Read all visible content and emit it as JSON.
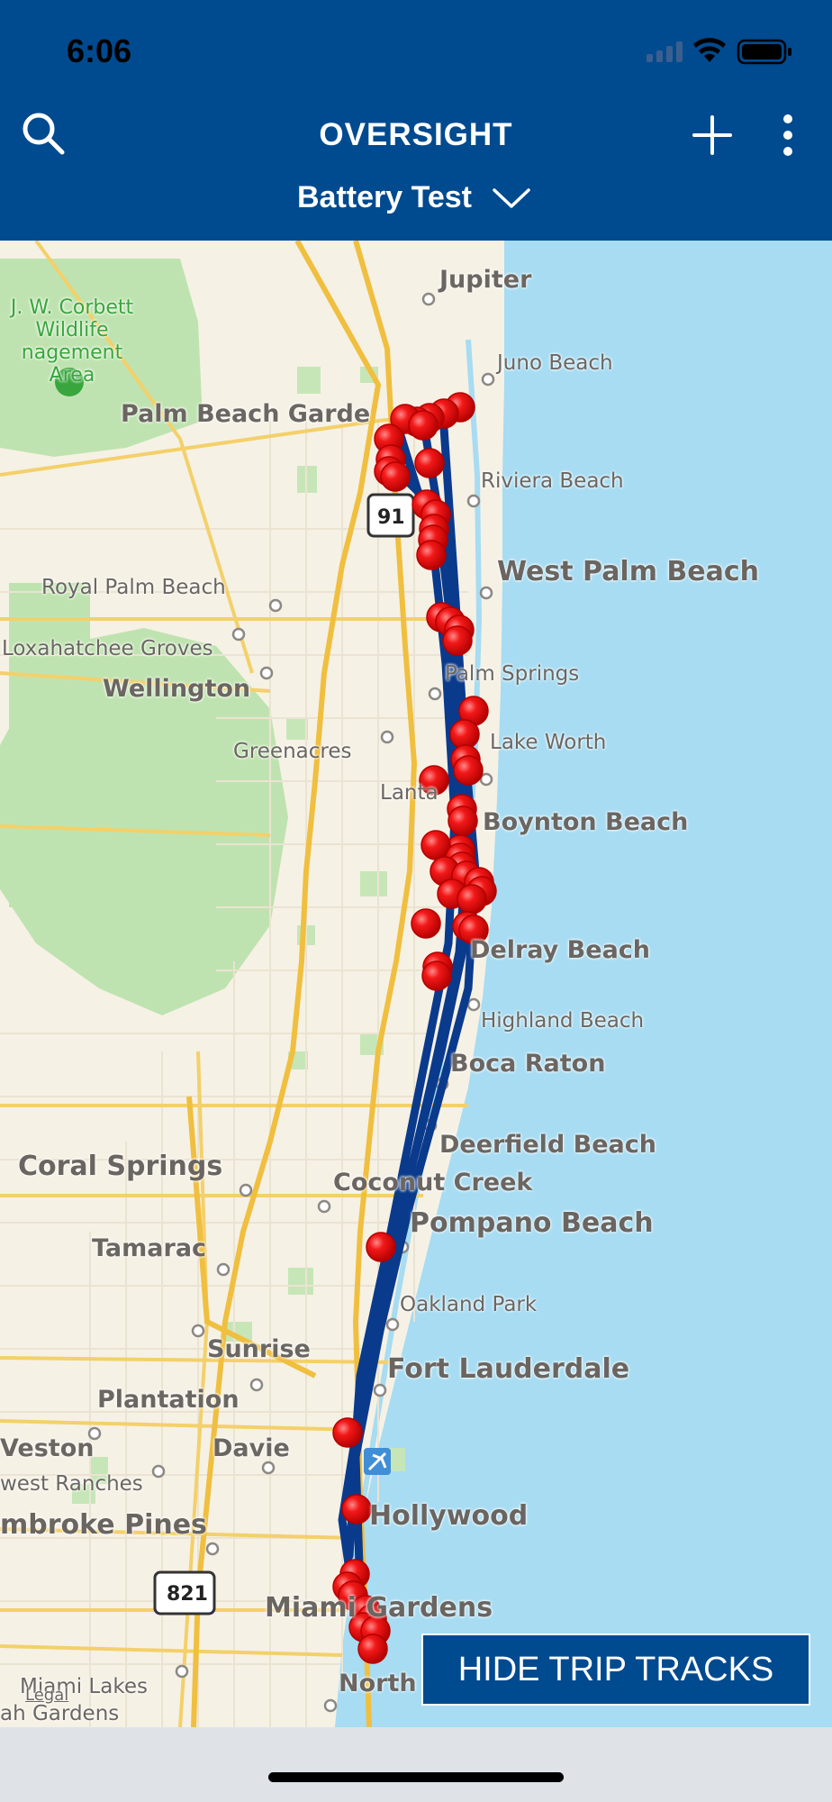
{
  "status_bar": {
    "time": "6:06"
  },
  "header": {
    "title": "OVERSIGHT",
    "subtitle": "Battery Test"
  },
  "map": {
    "labels": {
      "jupiter": "Jupiter",
      "juno_beach": "Juno Beach",
      "corbett": "J. W. Corbett\nWildlife\nnagement Area",
      "palm_beach_gardens": "Palm Beach Garde",
      "riviera_beach": "Riviera Beach",
      "west_palm_beach": "West Palm Beach",
      "royal_palm_beach": "Royal Palm Beach",
      "loxahatchee_groves": "Loxahatchee Groves",
      "wellington": "Wellington",
      "palm_springs": "Palm Springs",
      "greenacres": "Greenacres",
      "lake_worth": "Lake Worth",
      "lantana": "Lanta",
      "boynton_beach": "Boynton Beach",
      "delray_beach": "Delray Beach",
      "highland_beach": "Highland Beach",
      "boca_raton": "Boca Raton",
      "deerfield_beach": "Deerfield Beach",
      "coral_springs": "Coral Springs",
      "coconut_creek": "Coconut Creek",
      "pompano_beach": "Pompano Beach",
      "tamarac": "Tamarac",
      "oakland_park": "Oakland Park",
      "sunrise": "Sunrise",
      "fort_lauderdale": "Fort Lauderdale",
      "plantation": "Plantation",
      "weston": "Veston",
      "davie": "Davie",
      "west_ranches": "west Ranches",
      "hollywood": "Hollywood",
      "pembroke_pines": "mbroke Pines",
      "miami_gardens": "Miami Gardens",
      "miami_lakes": "Miami Lakes",
      "ah_gardens": "ah Gardens",
      "north": "North",
      "legal": "Legal",
      "hwy_91": "91",
      "hwy_821": "821"
    }
  },
  "actions": {
    "hide_trip_tracks": "HIDE TRIP TRACKS"
  },
  "colors": {
    "brand": "#004a8f",
    "track": "#0a3a8c",
    "marker": "#e8000a",
    "water": "#a7dcf2"
  }
}
